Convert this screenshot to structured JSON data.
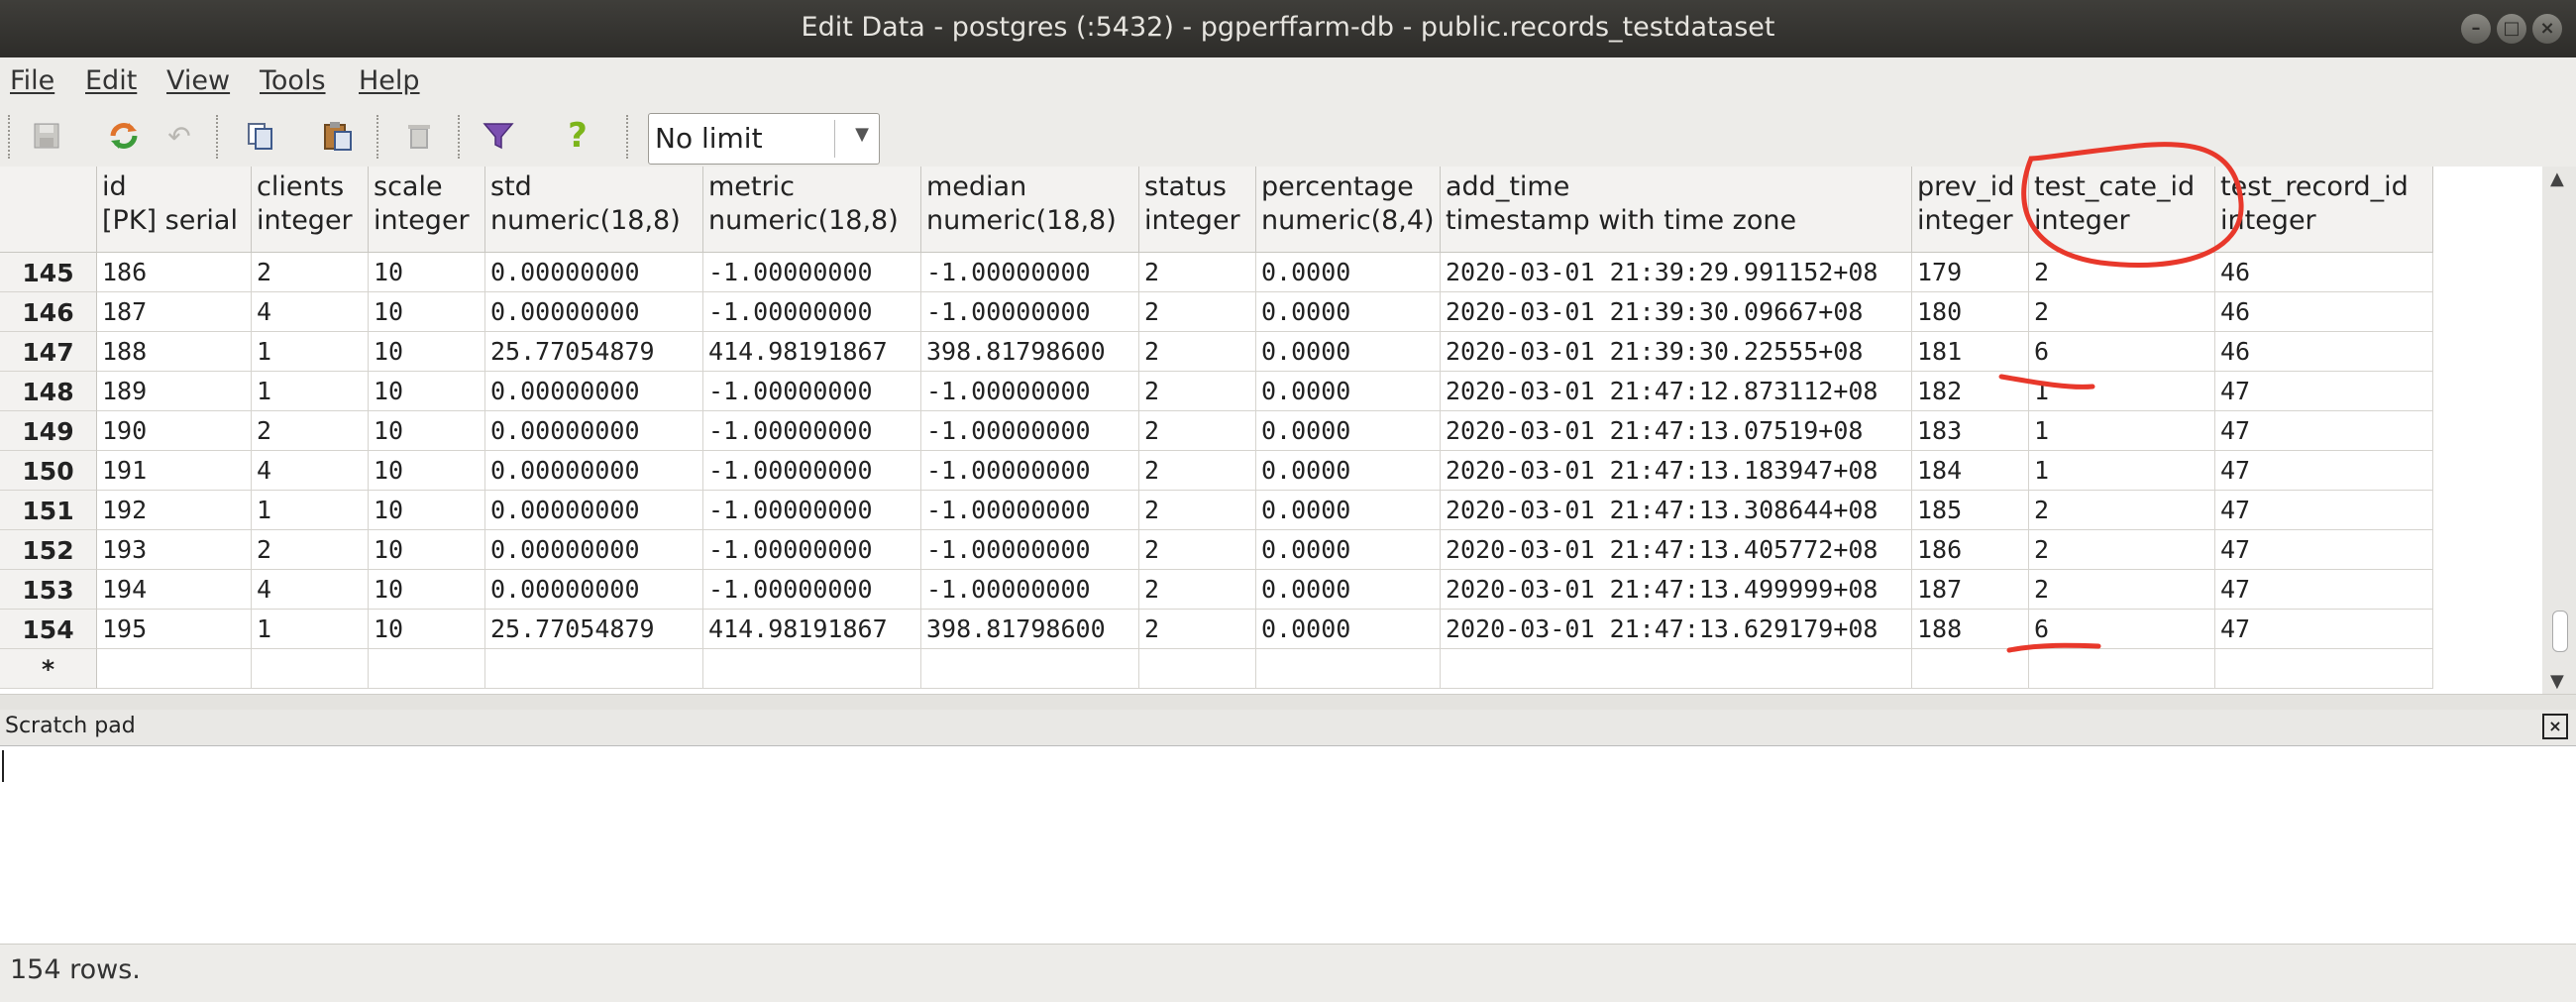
{
  "window": {
    "title": "Edit Data - postgres (:5432) - pgperffarm-db - public.records_testdataset"
  },
  "menu": [
    "File",
    "Edit",
    "View",
    "Tools",
    "Help"
  ],
  "toolbar": {
    "icons": [
      "save-icon",
      "refresh-icon",
      "undo-icon",
      "copy-icon",
      "paste-icon",
      "delete-icon",
      "filter-icon",
      "help-icon"
    ],
    "limit": "No limit"
  },
  "columns": [
    {
      "name": "id",
      "type": "[PK] serial"
    },
    {
      "name": "clients",
      "type": "integer"
    },
    {
      "name": "scale",
      "type": "integer"
    },
    {
      "name": "std",
      "type": "numeric(18,8)"
    },
    {
      "name": "metric",
      "type": "numeric(18,8)"
    },
    {
      "name": "median",
      "type": "numeric(18,8)"
    },
    {
      "name": "status",
      "type": "integer"
    },
    {
      "name": "percentage",
      "type": "numeric(8,4)"
    },
    {
      "name": "add_time",
      "type": "timestamp with time zone"
    },
    {
      "name": "prev_id",
      "type": "integer"
    },
    {
      "name": "test_cate_id",
      "type": "integer"
    },
    {
      "name": "test_record_id",
      "type": "integer"
    }
  ],
  "rows": [
    {
      "num": "145",
      "cells": [
        "186",
        "2",
        "10",
        "0.00000000",
        "-1.00000000",
        "-1.00000000",
        "2",
        "0.0000",
        "2020-03-01 21:39:29.991152+08",
        "179",
        "2",
        "46"
      ]
    },
    {
      "num": "146",
      "cells": [
        "187",
        "4",
        "10",
        "0.00000000",
        "-1.00000000",
        "-1.00000000",
        "2",
        "0.0000",
        "2020-03-01 21:39:30.09667+08",
        "180",
        "2",
        "46"
      ]
    },
    {
      "num": "147",
      "cells": [
        "188",
        "1",
        "10",
        "25.77054879",
        "414.98191867",
        "398.81798600",
        "2",
        "0.0000",
        "2020-03-01 21:39:30.22555+08",
        "181",
        "6",
        "46"
      ]
    },
    {
      "num": "148",
      "cells": [
        "189",
        "1",
        "10",
        "0.00000000",
        "-1.00000000",
        "-1.00000000",
        "2",
        "0.0000",
        "2020-03-01 21:47:12.873112+08",
        "182",
        "1",
        "47"
      ]
    },
    {
      "num": "149",
      "cells": [
        "190",
        "2",
        "10",
        "0.00000000",
        "-1.00000000",
        "-1.00000000",
        "2",
        "0.0000",
        "2020-03-01 21:47:13.07519+08",
        "183",
        "1",
        "47"
      ]
    },
    {
      "num": "150",
      "cells": [
        "191",
        "4",
        "10",
        "0.00000000",
        "-1.00000000",
        "-1.00000000",
        "2",
        "0.0000",
        "2020-03-01 21:47:13.183947+08",
        "184",
        "1",
        "47"
      ]
    },
    {
      "num": "151",
      "cells": [
        "192",
        "1",
        "10",
        "0.00000000",
        "-1.00000000",
        "-1.00000000",
        "2",
        "0.0000",
        "2020-03-01 21:47:13.308644+08",
        "185",
        "2",
        "47"
      ]
    },
    {
      "num": "152",
      "cells": [
        "193",
        "2",
        "10",
        "0.00000000",
        "-1.00000000",
        "-1.00000000",
        "2",
        "0.0000",
        "2020-03-01 21:47:13.405772+08",
        "186",
        "2",
        "47"
      ]
    },
    {
      "num": "153",
      "cells": [
        "194",
        "4",
        "10",
        "0.00000000",
        "-1.00000000",
        "-1.00000000",
        "2",
        "0.0000",
        "2020-03-01 21:47:13.499999+08",
        "187",
        "2",
        "47"
      ]
    },
    {
      "num": "154",
      "cells": [
        "195",
        "1",
        "10",
        "25.77054879",
        "414.98191867",
        "398.81798600",
        "2",
        "0.0000",
        "2020-03-01 21:47:13.629179+08",
        "188",
        "6",
        "47"
      ]
    }
  ],
  "new_row_marker": "*",
  "annotation_color": "#e8382b",
  "scratch_pad": {
    "label": "Scratch pad"
  },
  "status": {
    "text": "154 rows."
  }
}
